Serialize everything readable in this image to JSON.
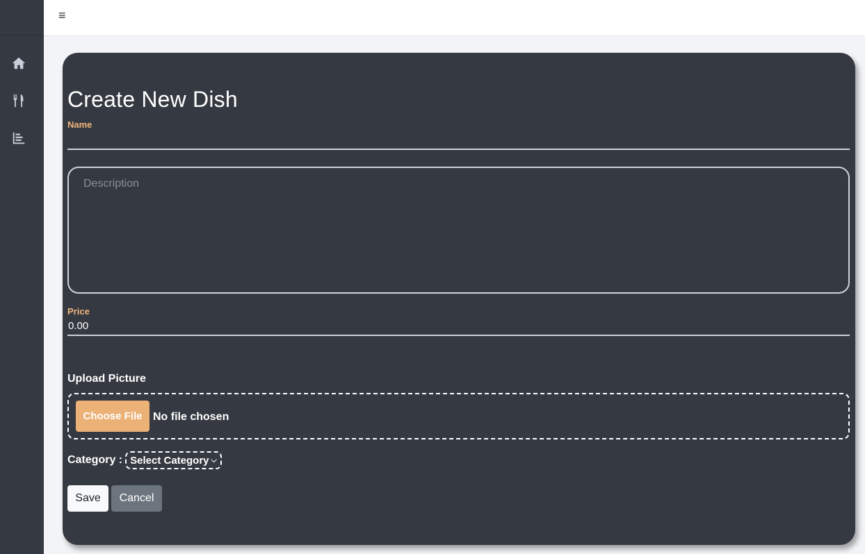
{
  "topbar": {
    "menu_icon": "hamburger-menu-icon",
    "menu_glyph": "≡"
  },
  "sidebar": {
    "items": [
      {
        "icon": "home-icon"
      },
      {
        "icon": "utensils-icon"
      },
      {
        "icon": "chart-bar-icon"
      }
    ]
  },
  "form": {
    "title": "Create New Dish",
    "name_label": "Name",
    "name_value": "",
    "description_placeholder": "Description",
    "price_label": "Price",
    "price_value": "0.00",
    "upload_label": "Upload Picture",
    "choose_file_label": "Choose File",
    "file_status": "No file chosen",
    "category_label": "Category :",
    "category_selected": "Select Category",
    "save_label": "Save",
    "cancel_label": "Cancel"
  },
  "colors": {
    "accent": "#ecb176",
    "label_accent": "#f0b57a",
    "card_bg": "#353941",
    "page_bg": "#f3f4f7",
    "cancel_bg": "#6c757d"
  }
}
